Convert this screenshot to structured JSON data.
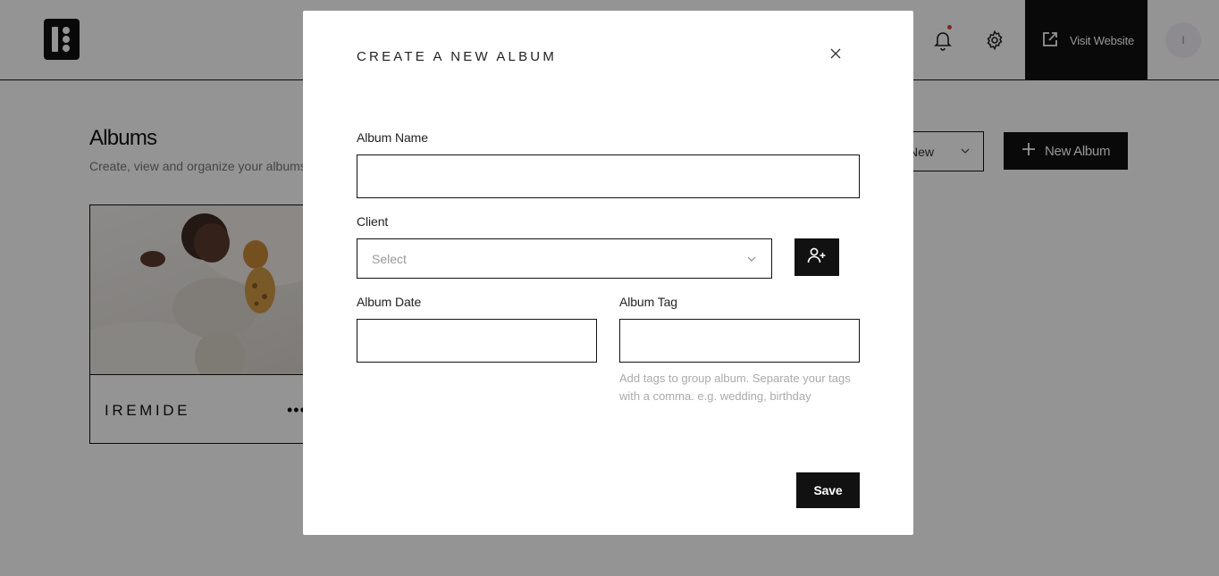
{
  "header": {
    "visit_label": "Visit Website",
    "avatar_initial": "I"
  },
  "page": {
    "title": "Albums",
    "subtitle": "Create, view and organize your albums",
    "sort_value": "New",
    "new_album_label": "New Album"
  },
  "albums": [
    {
      "name": "IREMIDE",
      "menu": "•••"
    }
  ],
  "modal": {
    "title": "CREATE A NEW ALBUM",
    "album_name_label": "Album Name",
    "album_name_value": "",
    "client_label": "Client",
    "client_placeholder": "Select",
    "album_date_label": "Album Date",
    "album_date_value": "",
    "album_tag_label": "Album Tag",
    "album_tag_value": "",
    "album_tag_hint": "Add tags to group album. Separate your tags with a comma. e.g. wedding, birthday",
    "save_label": "Save"
  },
  "colors": {
    "primary": "#111111",
    "overlay": "rgba(0,0,0,0.42)",
    "notification_dot": "#e0463a",
    "hint_text": "#aaaaaa"
  },
  "icons": {
    "logo": "logo-icon",
    "notifications": "bell-icon",
    "settings": "gear-icon",
    "visit": "external-link-icon",
    "add_album": "plus-icon",
    "dropdown": "chevron-down-icon",
    "close": "close-icon",
    "add_client": "user-plus-icon"
  }
}
